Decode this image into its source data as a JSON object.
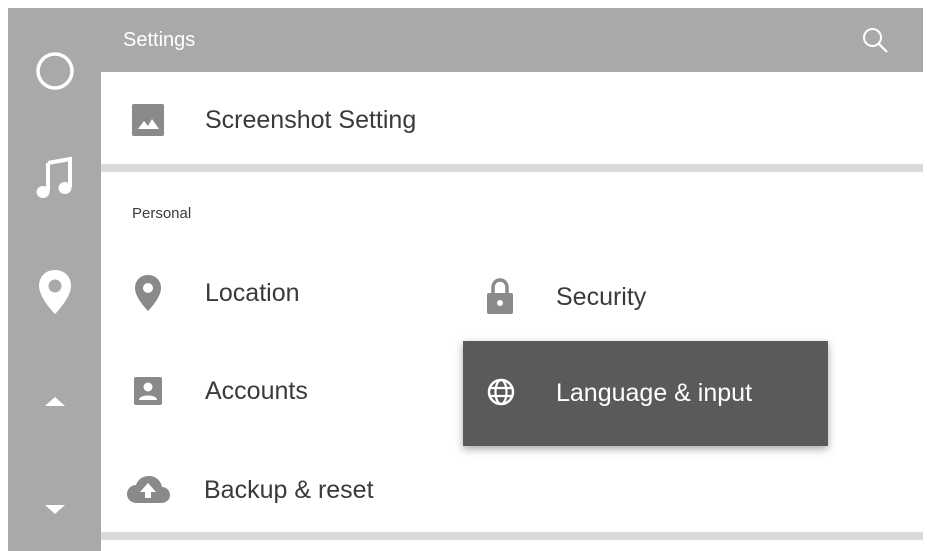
{
  "header": {
    "title": "Settings",
    "search_icon": "search-icon"
  },
  "rail": {
    "icons": [
      "circle-home-icon",
      "music-note-icon",
      "location-pin-icon",
      "arrow-up-icon",
      "arrow-down-icon"
    ]
  },
  "screenshot": {
    "label": "Screenshot Setting",
    "icon": "image-icon"
  },
  "personal": {
    "section_title": "Personal",
    "location": "Location",
    "security": "Security",
    "accounts": "Accounts",
    "language": "Language & input",
    "backup": "Backup & reset"
  },
  "colors": {
    "rail": "#a9a9a9",
    "popup": "#5a5a5c",
    "icon": "#8a8a8a",
    "separator": "#dadada"
  }
}
